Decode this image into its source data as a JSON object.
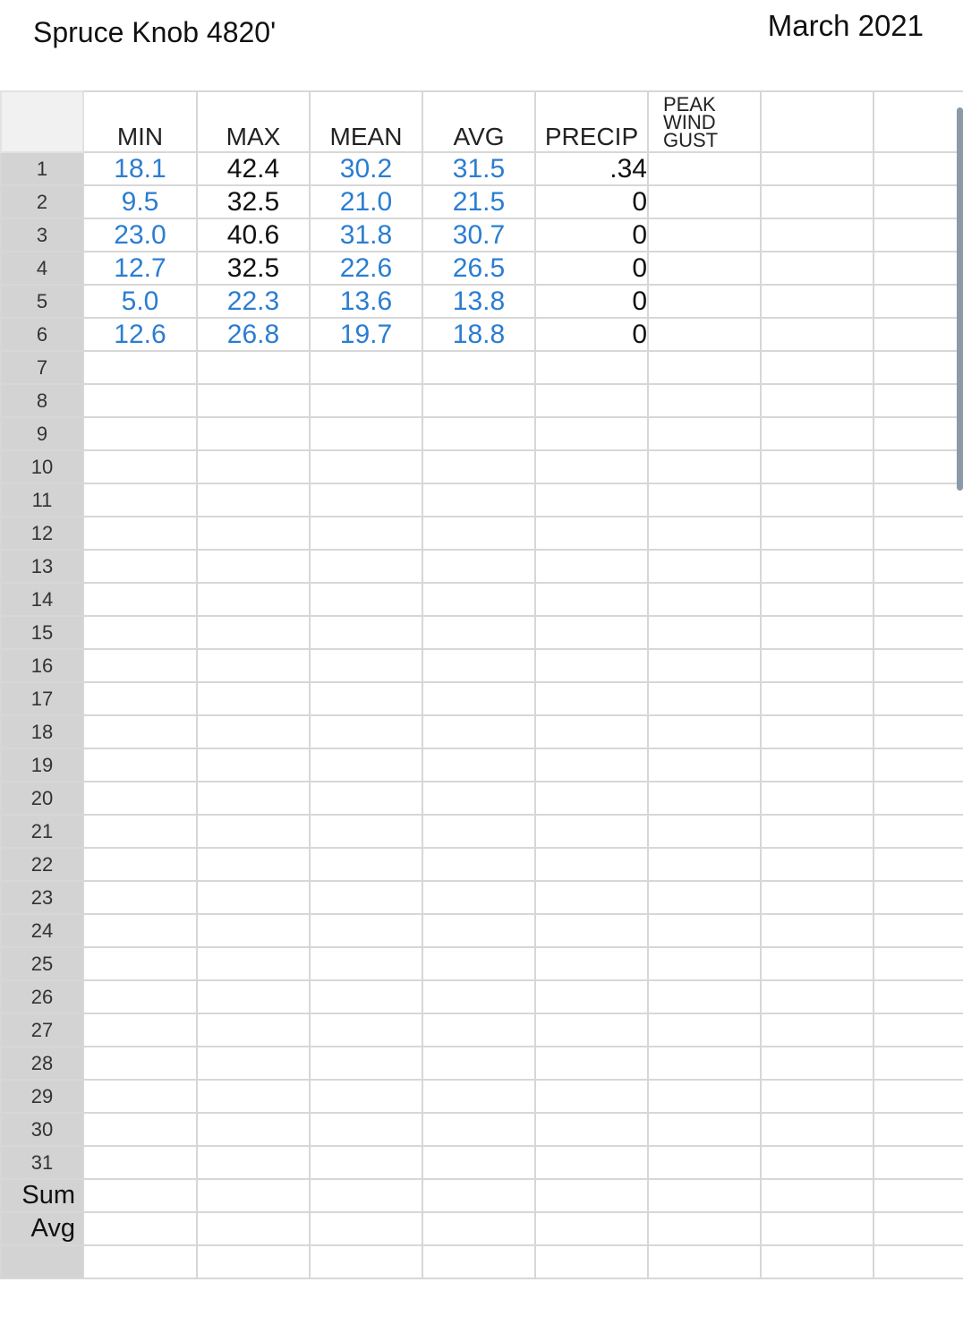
{
  "header": {
    "title": "Spruce Knob 4820'",
    "date": "March 2021"
  },
  "columns": [
    "MIN",
    "MAX",
    "MEAN",
    "AVG",
    "PRECIP",
    "PEAK WIND GUST",
    ""
  ],
  "peak_lines": [
    "PEAK",
    "WIND",
    "GUST"
  ],
  "rows": [
    {
      "label": "1",
      "min": "18.1",
      "max": "42.4",
      "mean": "30.2",
      "avg": "31.5",
      "precip": ".34"
    },
    {
      "label": "2",
      "min": "9.5",
      "max": "32.5",
      "mean": "21.0",
      "avg": "21.5",
      "precip": "0"
    },
    {
      "label": "3",
      "min": "23.0",
      "max": "40.6",
      "mean": "31.8",
      "avg": "30.7",
      "precip": "0"
    },
    {
      "label": "4",
      "min": "12.7",
      "max": "32.5",
      "mean": "22.6",
      "avg": "26.5",
      "precip": "0"
    },
    {
      "label": "5",
      "min": "5.0",
      "max": "22.3",
      "mean": "13.6",
      "avg": "13.8",
      "precip": "0"
    },
    {
      "label": "6",
      "min": "12.6",
      "max": "26.8",
      "mean": "19.7",
      "avg": "18.8",
      "precip": "0"
    },
    {
      "label": "7"
    },
    {
      "label": "8"
    },
    {
      "label": "9"
    },
    {
      "label": "10"
    },
    {
      "label": "11"
    },
    {
      "label": "12"
    },
    {
      "label": "13"
    },
    {
      "label": "14"
    },
    {
      "label": "15"
    },
    {
      "label": "16"
    },
    {
      "label": "17"
    },
    {
      "label": "18"
    },
    {
      "label": "19"
    },
    {
      "label": "20"
    },
    {
      "label": "21"
    },
    {
      "label": "22"
    },
    {
      "label": "23"
    },
    {
      "label": "24"
    },
    {
      "label": "25"
    },
    {
      "label": "26"
    },
    {
      "label": "27"
    },
    {
      "label": "28"
    },
    {
      "label": "29"
    },
    {
      "label": "30"
    },
    {
      "label": "31"
    },
    {
      "label": "Sum"
    },
    {
      "label": "Avg"
    },
    {
      "label": ""
    }
  ],
  "max_black_rows": [
    0,
    1,
    2,
    3
  ],
  "colors": {
    "value_blue": "#2b7dd1",
    "value_black": "#111111",
    "row_header_bg": "#d3d3d3",
    "freeze_line": "#2e7b4a",
    "grid_line": "#d7d7d7"
  }
}
